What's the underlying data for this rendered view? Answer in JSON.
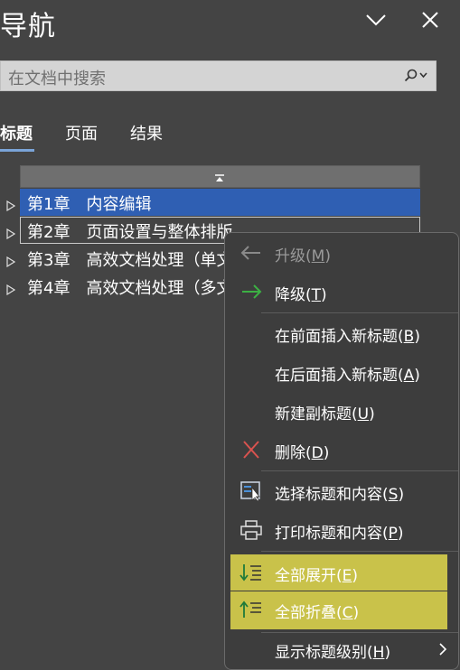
{
  "pane": {
    "title": "导航",
    "search_placeholder": "在文档中搜索",
    "tabs": [
      {
        "label": "标题",
        "active": true
      },
      {
        "label": "页面",
        "active": false
      },
      {
        "label": "结果",
        "active": false
      }
    ],
    "headings": [
      {
        "label": "第1章　内容编辑",
        "selected": true
      },
      {
        "label": "第2章　页面设置与整体排版",
        "focused": true
      },
      {
        "label": "第3章　高效文档处理（单文"
      },
      {
        "label": "第4章　高效文档处理（多文"
      }
    ]
  },
  "context_menu": {
    "items": [
      {
        "label": "升级(M)",
        "icon": "arrow-left-icon",
        "disabled": true
      },
      {
        "label": "降级(T)",
        "icon": "arrow-right-icon"
      },
      {
        "label": "在前面插入新标题(B)"
      },
      {
        "label": "在后面插入新标题(A)"
      },
      {
        "label": "新建副标题(U)"
      },
      {
        "label": "删除(D)",
        "icon": "delete-x-icon"
      },
      {
        "label": "选择标题和内容(S)",
        "icon": "select-content-icon"
      },
      {
        "label": "打印标题和内容(P)",
        "icon": "printer-icon"
      },
      {
        "label": "全部展开(E)",
        "icon": "expand-all-icon",
        "highlighted": true
      },
      {
        "label": "全部折叠(C)",
        "icon": "collapse-all-icon",
        "highlighted": true
      },
      {
        "label": "显示标题级别(H)",
        "has_submenu": true
      }
    ]
  },
  "colors": {
    "background": "#444444",
    "selection": "#2f5fb3",
    "highlight": "#c9c24a",
    "delete_red": "#d9534f",
    "arrow_green": "#3cb043"
  }
}
